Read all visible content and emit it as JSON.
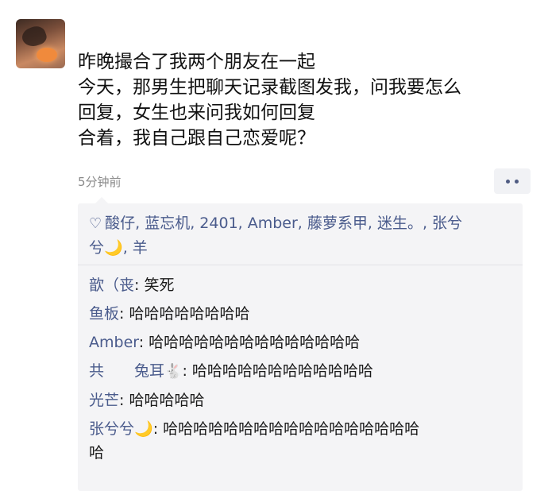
{
  "post": {
    "lines": [
      "昨晚撮合了我两个朋友在一起",
      "今天，那男生把聊天记录截图发我，问我要怎么",
      "回复，女生也来问我如何回复",
      "合着，我自己跟自己恋爱呢？"
    ],
    "time": "5分钟前"
  },
  "likes": {
    "icon": "heart-outline-icon",
    "line1": "酸仔, 蓝忘机, 2401, Amber, 藤萝系甲, 迷生。, 张兮",
    "line2_a": "兮",
    "line2_moon": "🌙",
    "line2_b": ", 羊"
  },
  "comments": [
    {
      "name": "歆（丧",
      "text": ": 笑死"
    },
    {
      "name": "鱼板",
      "text": ": 哈哈哈哈哈哈哈哈"
    },
    {
      "name": "Amber",
      "text": ": 哈哈哈哈哈哈哈哈哈哈哈哈哈哈"
    },
    {
      "name": "共　　兔耳",
      "emoji": "🐇",
      "text": ": 哈哈哈哈哈哈哈哈哈哈哈哈"
    },
    {
      "name": "光芒",
      "text": ": 哈哈哈哈哈"
    },
    {
      "name": "张兮兮",
      "emoji": "🌙",
      "text": ": 哈哈哈哈哈哈哈哈哈哈哈哈哈哈哈哈哈",
      "text2": "哈"
    }
  ],
  "colors": {
    "name_color": "#4a5b8c",
    "comment_bg": "#f4f4f6",
    "time_color": "#8a8a8a"
  }
}
